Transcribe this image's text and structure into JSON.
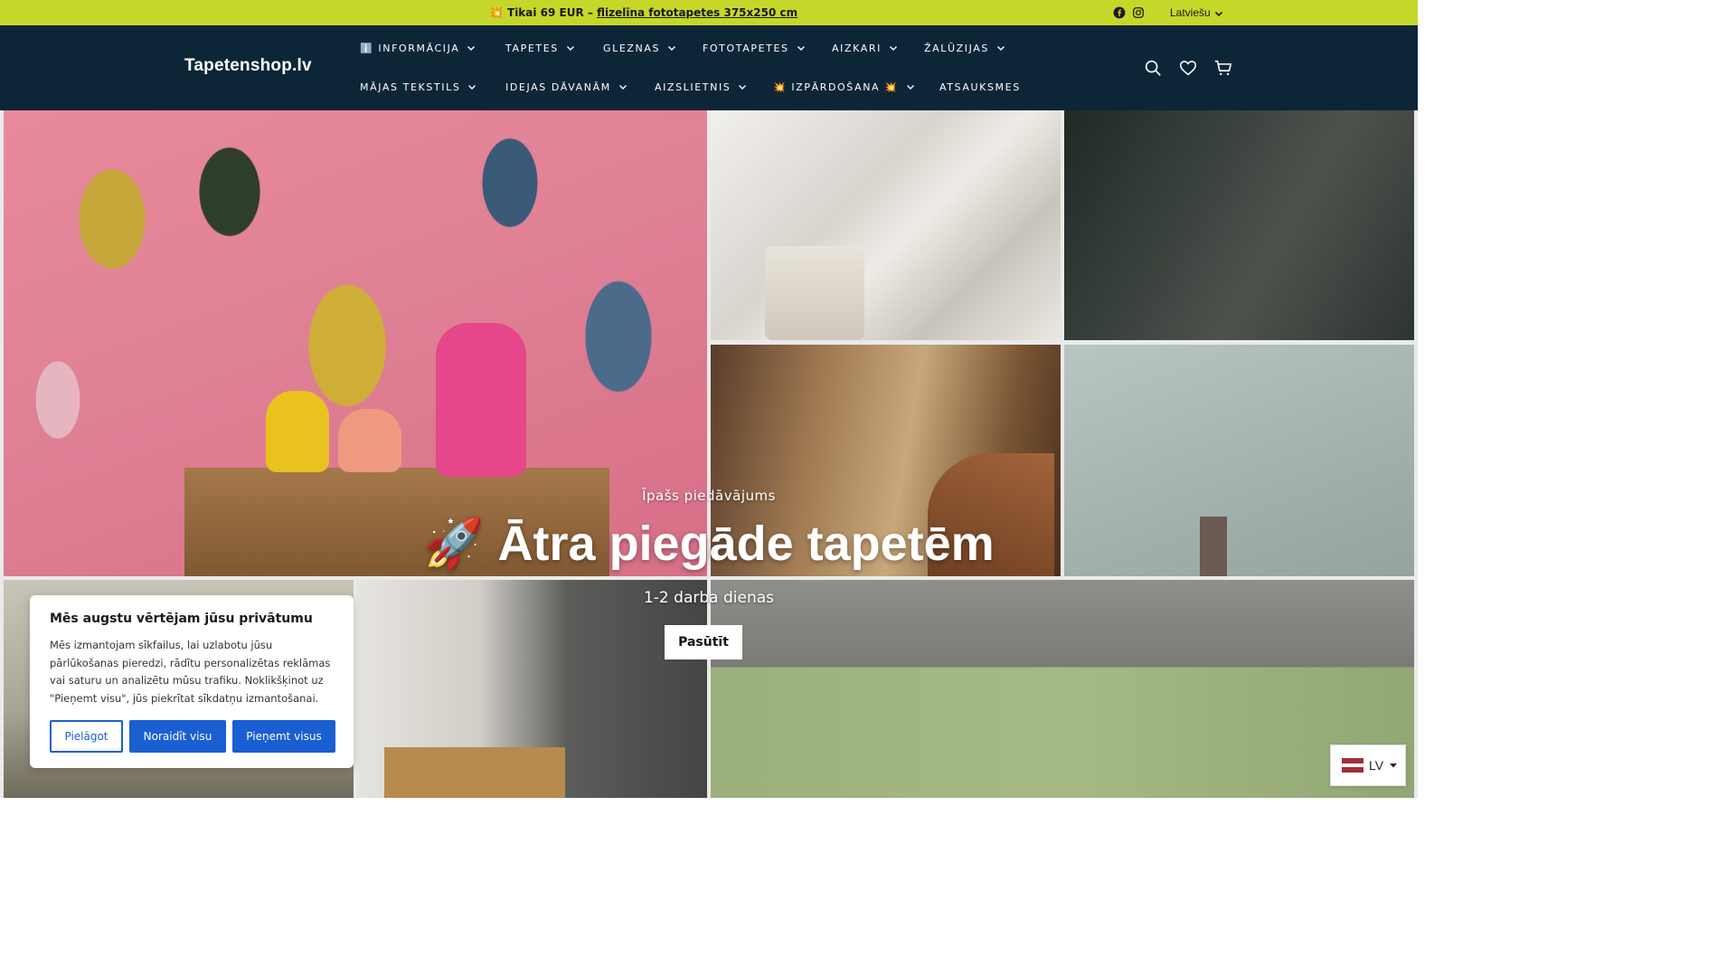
{
  "announcement": {
    "prefix": "💥 Tikai 69 EUR – ",
    "link_text": "flizelīna fototapetes 375x250 cm"
  },
  "topbar": {
    "language": "Latviešu",
    "icons": [
      "facebook-icon",
      "instagram-icon"
    ]
  },
  "header": {
    "logo": "Tapetenshop.lv",
    "nav_row1": [
      {
        "label": "ℹ️ INFORMĀCIJA"
      },
      {
        "label": "TAPETES"
      },
      {
        "label": "GLEZNAS"
      },
      {
        "label": "FOTOTAPETES"
      },
      {
        "label": "AIZKARI"
      },
      {
        "label": "ŽALŪZIJAS"
      }
    ],
    "nav_row2": [
      {
        "label": "MĀJAS TEKSTILS"
      },
      {
        "label": "IDEJAS DĀVANĀM"
      },
      {
        "label": "AIZSLIETNIS"
      },
      {
        "label": "💥 IZPĀRDOŠANA 💥"
      },
      {
        "label": "ATSAUKSMES"
      }
    ],
    "icons": [
      "search-icon",
      "heart-icon",
      "cart-icon"
    ]
  },
  "hero": {
    "eyebrow": "Īpašs piedāvājums",
    "headline": "🚀 Ātra piegāde tapetēm",
    "subline": "1-2 darba dienas",
    "cta": "Pasūtīt"
  },
  "cookie_banner": {
    "title": "Mēs augstu vērtējam jūsu privātumu",
    "body": "Mēs izmantojam sīkfailus, lai uzlabotu jūsu pārlūkošanas pieredzi, rādītu personalizētas reklāmas vai saturu un analizētu mūsu trafiku. Noklikšķinot uz \"Pieņemt visu\", jūs piekrītat sīkdatņu izmantošanai.",
    "customize": "Pielāgot",
    "reject": "Noraidīt visu",
    "accept": "Pieņemt visus"
  },
  "language_widget": {
    "code": "LV"
  },
  "colors": {
    "topbar": "#c5d82a",
    "header": "#0c2638",
    "cookie_button": "#1a5fd1"
  }
}
